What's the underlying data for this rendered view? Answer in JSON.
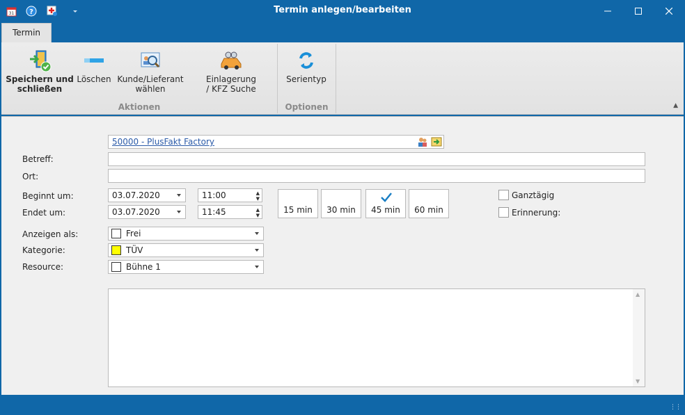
{
  "window": {
    "title": "Termin anlegen/bearbeiten",
    "qat_icons": [
      "calendar-icon",
      "help-icon",
      "add-icon",
      "dropdown-arrow-icon"
    ],
    "controls": [
      "minimize",
      "maximize",
      "close"
    ]
  },
  "tabs": [
    {
      "label": "Termin",
      "active": true
    }
  ],
  "ribbon": {
    "groups": [
      {
        "label": "Aktionen",
        "buttons": [
          {
            "label_line1": "Speichern und",
            "label_line2": "schließen",
            "icon": "save-close-icon"
          },
          {
            "label_line1": "Löschen",
            "label_line2": "",
            "icon": "delete-icon"
          },
          {
            "label_line1": "Kunde/Lieferant",
            "label_line2": "wählen",
            "icon": "customer-search-icon"
          },
          {
            "label_line1": "Einlagerung",
            "label_line2": "/ KFZ Suche",
            "icon": "car-search-icon"
          }
        ]
      },
      {
        "label": "Optionen",
        "buttons": [
          {
            "label_line1": "Serientyp",
            "label_line2": "",
            "icon": "recurrence-icon"
          }
        ]
      }
    ]
  },
  "form": {
    "customer_link": "50000 - PlusFakt Factory",
    "subject_label": "Betreff:",
    "subject_value": "",
    "location_label": "Ort:",
    "location_value": "",
    "start_label": "Beginnt um:",
    "start_date": "03.07.2020",
    "start_time": "11:00",
    "end_label": "Endet um:",
    "end_date": "03.07.2020",
    "end_time": "11:45",
    "durations": [
      {
        "label": "15 min",
        "selected": false
      },
      {
        "label": "30 min",
        "selected": false
      },
      {
        "label": "45 min",
        "selected": true
      },
      {
        "label": "60 min",
        "selected": false
      }
    ],
    "allday_label": "Ganztägig",
    "allday_checked": false,
    "reminder_label": "Erinnerung:",
    "reminder_checked": false,
    "showas_label": "Anzeigen als:",
    "showas_value": "Frei",
    "showas_color": "#ffffff",
    "category_label": "Kategorie:",
    "category_value": "TÜV",
    "category_color": "#ffff00",
    "resource_label": "Resource:",
    "resource_value": "Bühne 1",
    "resource_color": "#ffffff",
    "notes": ""
  },
  "colors": {
    "titlebar": "#1067a8",
    "ribbon": "#e6e6e6",
    "form_bg": "#f0f0f0",
    "accent_check": "#1a7fc4"
  }
}
